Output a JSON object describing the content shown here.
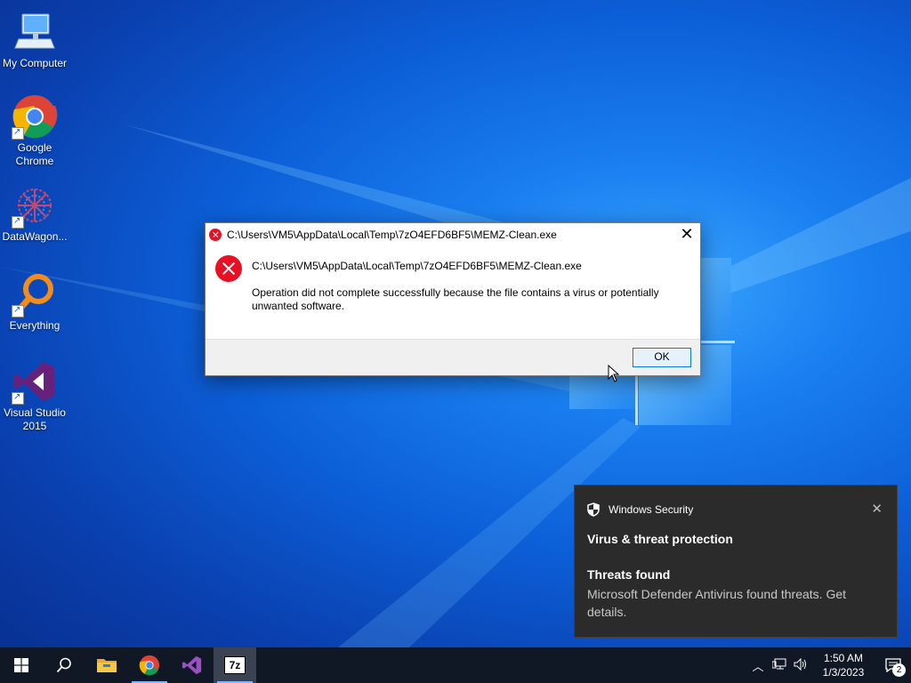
{
  "desktop": {
    "icons": [
      {
        "label": "My Computer",
        "icon": "computer-icon"
      },
      {
        "label": "Google Chrome",
        "icon": "chrome-icon"
      },
      {
        "label": "DataWagon...",
        "icon": "datawagon-icon"
      },
      {
        "label": "Everything",
        "icon": "everything-search-icon"
      },
      {
        "label": "Visual Studio 2015",
        "icon": "visual-studio-icon"
      }
    ]
  },
  "dialog": {
    "title": "C:\\Users\\VM5\\AppData\\Local\\Temp\\7zO4EFD6BF5\\MEMZ-Clean.exe",
    "path": "C:\\Users\\VM5\\AppData\\Local\\Temp\\7zO4EFD6BF5\\MEMZ-Clean.exe",
    "message": "Operation did not complete successfully because the file contains a virus or potentially unwanted software.",
    "ok_label": "OK",
    "close_glyph": "✕"
  },
  "toast": {
    "app": "Windows Security",
    "heading": "Virus & threat protection",
    "title": "Threats found",
    "body": "Microsoft Defender Antivirus found threats. Get details.",
    "close_glyph": "✕"
  },
  "taskbar": {
    "pinned": [
      "start-icon",
      "search-icon",
      "file-explorer-icon",
      "chrome-icon",
      "visual-studio-icon",
      "7zip-icon"
    ],
    "sevenzip_label": "7z",
    "clock_time": "1:50 AM",
    "clock_date": "1/3/2023",
    "notification_count": "2"
  },
  "colors": {
    "error_red": "#e81123",
    "accent_blue": "#0078d7",
    "taskbar": "#101826",
    "toast_bg": "#2b2b2b"
  }
}
